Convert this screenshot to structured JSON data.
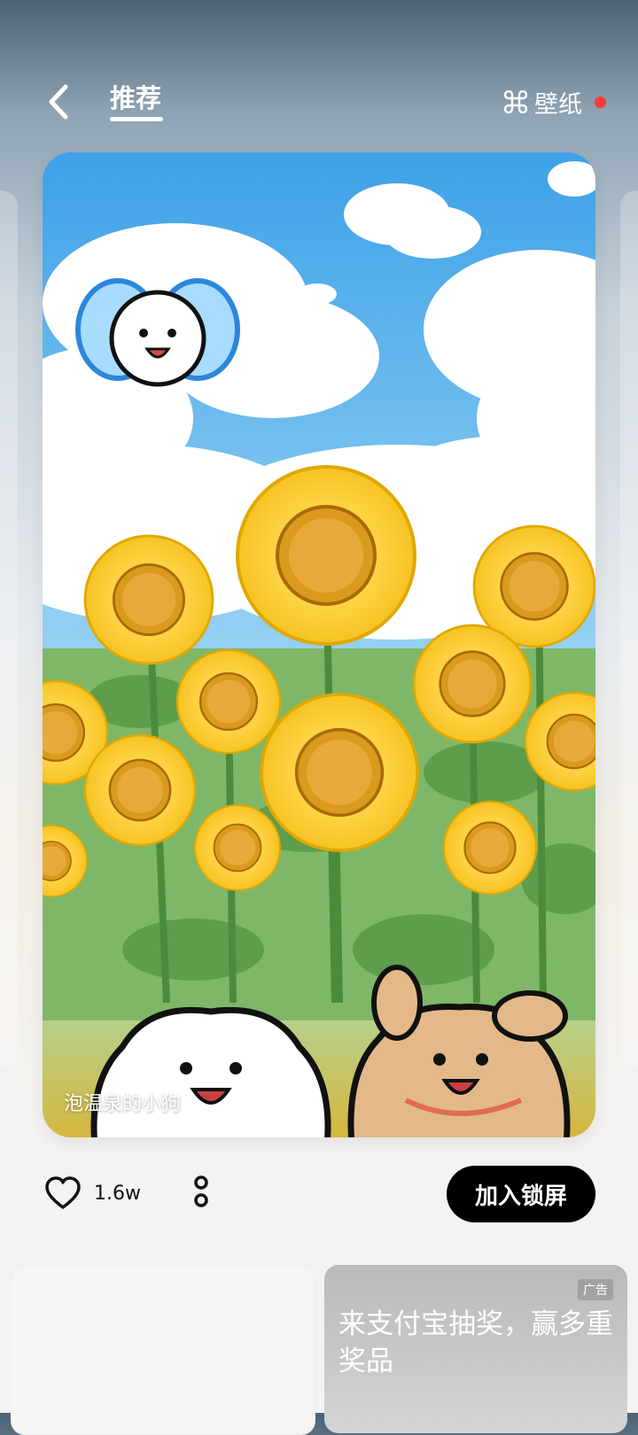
{
  "header": {
    "tab_active": "推荐",
    "wallpaper_label": "壁纸",
    "accent_dot_color": "#ff3b3b"
  },
  "main_card": {
    "caption": "泡温泉的小狗",
    "image_description_icon": "sunflower-puppies-illustration"
  },
  "actions": {
    "like_count": "1.6w",
    "like_icon": "heart-outline-icon",
    "more_icon": "vertical-dots-icon",
    "add_lock_label": "加入锁屏"
  },
  "bottom": {
    "ad_badge": "广告",
    "ad_text": "来支付宝抽奖，赢多重奖品"
  }
}
